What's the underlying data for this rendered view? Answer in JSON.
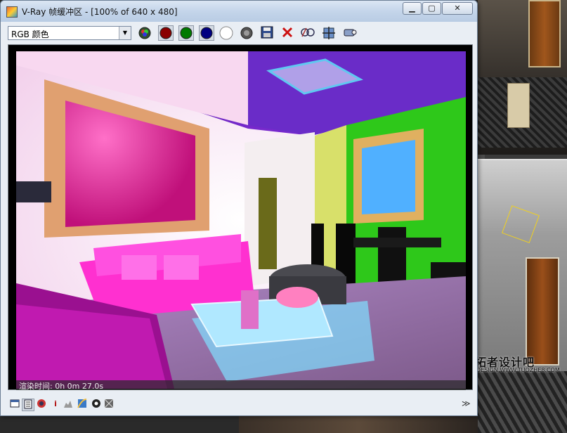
{
  "window": {
    "title": "V-Ray 帧缓冲区 - [100% of 640 x 480]",
    "buttons": {
      "minimize": "▁",
      "maximize": "▢",
      "close": "✕"
    }
  },
  "toolbar": {
    "channel": {
      "selected": "RGB 颜色"
    },
    "buttons": [
      {
        "name": "rgb-channels-icon",
        "color": "#5a8a5a"
      },
      {
        "name": "red-channel-icon",
        "color": "#8a0000"
      },
      {
        "name": "green-channel-icon",
        "color": "#007a00"
      },
      {
        "name": "blue-channel-icon",
        "color": "#000080"
      },
      {
        "name": "alpha-channel-icon",
        "color": "#ffffff"
      },
      {
        "name": "monochrome-icon",
        "color": "#444444"
      },
      {
        "name": "save-icon"
      },
      {
        "name": "clear-icon"
      },
      {
        "name": "duplicate-to-max-icon"
      },
      {
        "name": "track-mouse-icon"
      },
      {
        "name": "render-region-icon"
      }
    ]
  },
  "status": {
    "render_time": "渲染时间: 0h 0m 27.0s"
  },
  "bottom_toolbar": {
    "buttons": [
      {
        "name": "display-correction-icon"
      },
      {
        "name": "pixel-info-icon"
      },
      {
        "name": "color-clamp-icon"
      },
      {
        "name": "info-icon",
        "glyph": "i"
      },
      {
        "name": "levels-icon"
      },
      {
        "name": "curves-icon"
      },
      {
        "name": "settings-icon"
      },
      {
        "name": "history-icon"
      }
    ],
    "expand": "≫"
  },
  "watermark": {
    "text": "拓者设计吧",
    "sub": "DESIGN  WWW.TUOZHE8.COM"
  }
}
